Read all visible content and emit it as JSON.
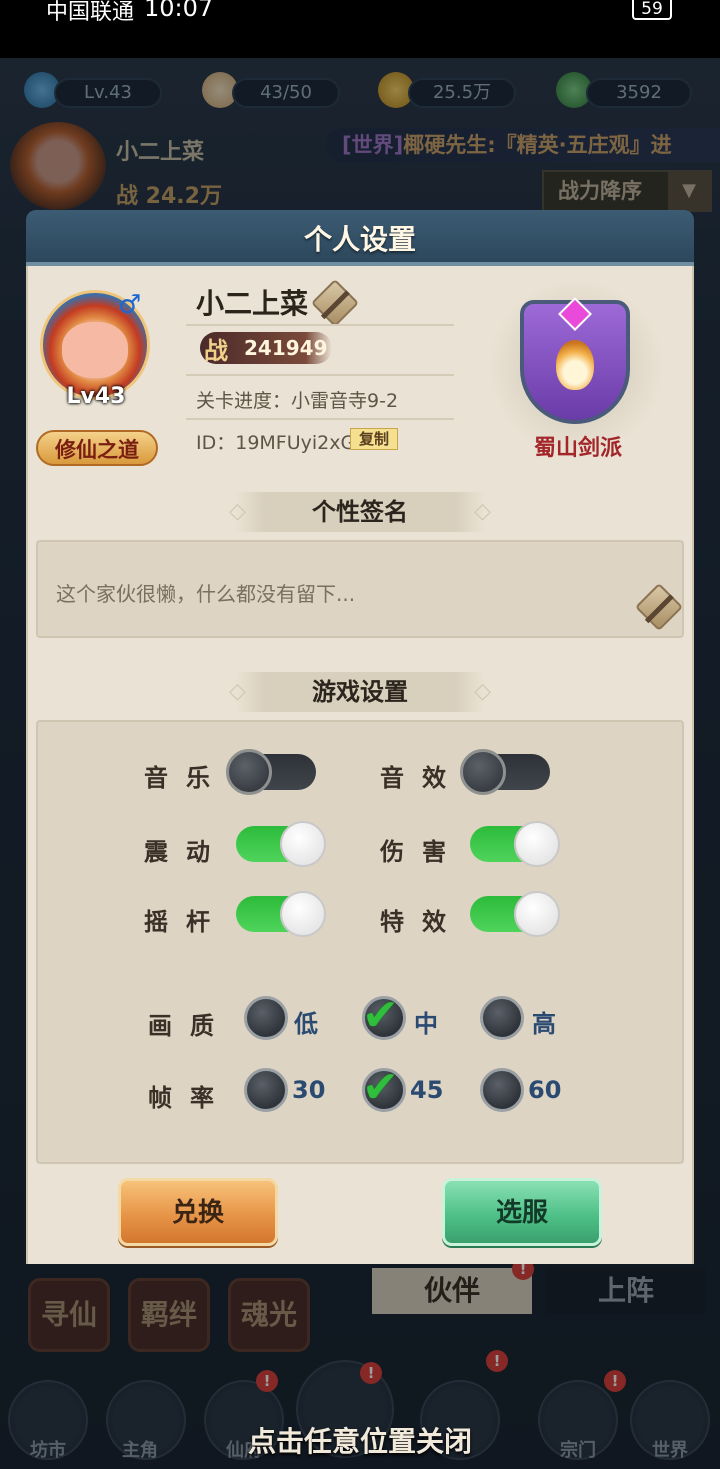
{
  "status_bar": {
    "carrier": "中国联通",
    "time": "10:07",
    "battery": "59"
  },
  "top_resources": [
    {
      "icon": "level-swirl-icon",
      "value": "Lv.43"
    },
    {
      "icon": "bun-stamina-icon",
      "value": "43/50"
    },
    {
      "icon": "copper-coin-icon",
      "value": "25.5万"
    },
    {
      "icon": "jade-gem-icon",
      "value": "3592"
    }
  ],
  "hero": {
    "name": "小二上菜",
    "power": "战 24.2万"
  },
  "world_chat": {
    "tag": "[世界]",
    "text": "椰硬先生:『精英·五庄观』进"
  },
  "sort": {
    "label": "战力降序",
    "arrow": "▼"
  },
  "dialog": {
    "title": "个人设置",
    "profile": {
      "name": "小二上菜",
      "gender_symbol": "♂",
      "level": "Lv43",
      "cultivation_badge": "修仙之道",
      "power_label": "战",
      "power_value": "241949",
      "progress": "关卡进度：小雷音寺9-2",
      "uid": "ID：19MFUyi2xG",
      "copy_label": "复制",
      "sect_name": "蜀山剑派"
    },
    "signature": {
      "title": "个性签名",
      "text": "这个家伙很懒，什么都没有留下..."
    },
    "game_settings": {
      "title": "游戏设置",
      "toggles": [
        {
          "label": "音乐",
          "on": false
        },
        {
          "label": "音效",
          "on": false
        },
        {
          "label": "震动",
          "on": true
        },
        {
          "label": "伤害",
          "on": true
        },
        {
          "label": "摇杆",
          "on": true
        },
        {
          "label": "特效",
          "on": true
        }
      ],
      "quality": {
        "label": "画质",
        "options": [
          "低",
          "中",
          "高"
        ],
        "selected": "中"
      },
      "framerate": {
        "label": "帧率",
        "options": [
          "30",
          "45",
          "60"
        ],
        "selected": "45"
      }
    },
    "buttons": {
      "redeem": "兑换",
      "server": "选服"
    }
  },
  "background": {
    "tabs": [
      "伙伴",
      "上阵"
    ],
    "side_buttons": [
      "寻仙",
      "羁绊",
      "魂光"
    ],
    "nav": [
      "坊市",
      "主角",
      "仙府",
      "宗门",
      "世界"
    ],
    "badge": "!"
  },
  "close_hint": "点击任意位置关闭",
  "colors": {
    "toggle_on": "#2dbb3b",
    "toggle_off": "#2e3238",
    "accent_red": "#a2262a",
    "check": "#2fbf3c"
  }
}
